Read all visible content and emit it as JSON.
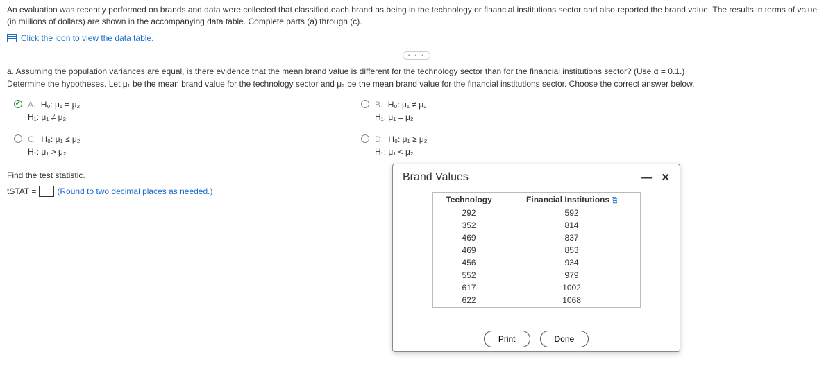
{
  "intro": "An evaluation was recently performed on brands and data were collected that classified each brand as being in the technology or financial institutions sector and also reported the brand value. The results in terms of value (in millions of dollars) are shown in the accompanying data table. Complete parts (a) through (c).",
  "datatable_link": "Click the icon to view the data table.",
  "dots": "• • •",
  "partA_q1": "a. Assuming the population variances are equal, is there evidence that the mean brand value is different for the technology sector than for the financial institutions sector? (Use α = 0.1.)",
  "partA_q2": "Determine the hypotheses. Let μ₁ be the mean brand value for the technology sector and μ₂ be the mean brand value for the financial institutions sector. Choose the correct answer below.",
  "options": {
    "A": {
      "label": "A.",
      "h0": "H₀: μ₁ = μ₂",
      "h1": "H₁: μ₁ ≠ μ₂"
    },
    "B": {
      "label": "B.",
      "h0": "H₀: μ₁ ≠ μ₂",
      "h1": "H₁: μ₁ = μ₂"
    },
    "C": {
      "label": "C.",
      "h0": "H₀: μ₁ ≤ μ₂",
      "h1": "H₁: μ₁ > μ₂"
    },
    "D": {
      "label": "D.",
      "h0": "H₀: μ₁ ≥ μ₂",
      "h1": "H₁: μ₁ < μ₂"
    }
  },
  "find_stat": "Find the test statistic.",
  "tstat_prefix": "tSTAT =",
  "tstat_hint": "(Round to two decimal places as needed.)",
  "modal": {
    "title": "Brand Values",
    "headers": {
      "tech": "Technology",
      "fin": "Financial Institutions"
    },
    "tech": [
      "292",
      "352",
      "469",
      "469",
      "456",
      "552",
      "617",
      "622"
    ],
    "fin": [
      "592",
      "814",
      "837",
      "853",
      "934",
      "979",
      "1002",
      "1068"
    ],
    "print": "Print",
    "done": "Done",
    "minimize": "—",
    "close": "✕"
  }
}
